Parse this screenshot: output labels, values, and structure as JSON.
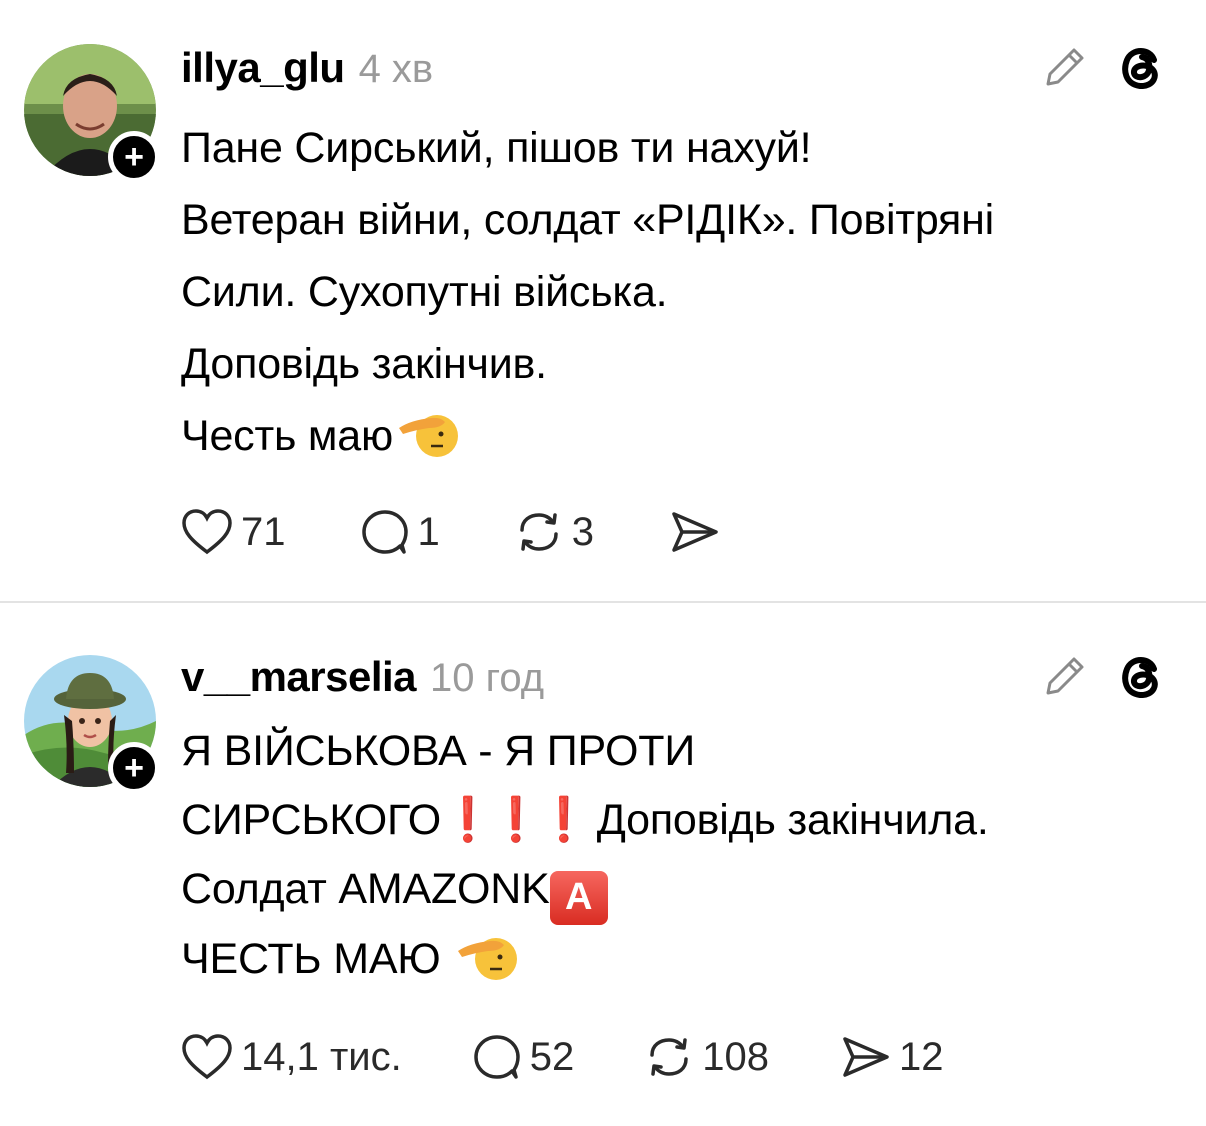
{
  "posts": [
    {
      "username": "illya_glu",
      "timestamp": "4 хв",
      "lines": [
        "Пане Сирський, пішов ти нахуй!",
        "Ветеран війни, солдат «РІДІК». Повітряні",
        "Сили. Сухопутні війська.",
        "Доповідь закінчив.",
        "Честь маю"
      ],
      "emoji": "saluting-face",
      "likes": "71",
      "replies": "1",
      "reposts": "3",
      "shares": ""
    },
    {
      "username": "v__marselia",
      "timestamp": "10 год",
      "lines": [
        "Я ВІЙСЬКОВА - Я ПРОТИ",
        "СИРСЬКОГО",
        "Доповідь закінчила.",
        "Солдат AMAZONK",
        "ЧЕСТЬ МАЮ"
      ],
      "exclamation": "❗",
      "badge_letter": "A",
      "emoji": "saluting-face",
      "likes": "14,1 тис.",
      "replies": "52",
      "reposts": "108",
      "shares": "12"
    }
  ],
  "colors": {
    "timestamp": "#9a9a9a",
    "divider": "#e3e3e3",
    "exclamation": "#e2232c"
  }
}
